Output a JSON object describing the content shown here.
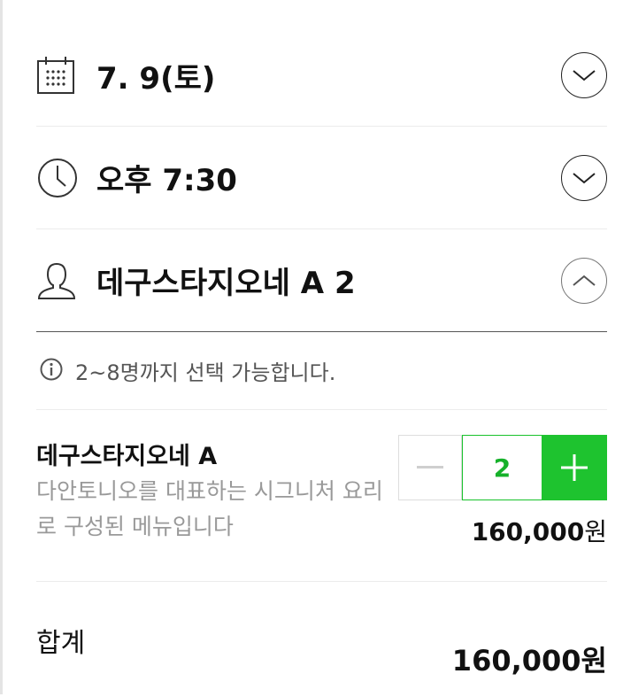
{
  "date": {
    "label": "7. 9(토)",
    "icon": "calendar-icon"
  },
  "time": {
    "label": "오후 7:30",
    "icon": "clock-icon"
  },
  "guest": {
    "label": "데구스타지오네 A 2",
    "icon": "person-icon"
  },
  "info": {
    "text": "2~8명까지 선택 가능합니다.",
    "icon": "info-icon"
  },
  "menu": {
    "name": "데구스타지오네 A",
    "description": "다안토니오를 대표하는 시그니처 요리로 구성된 메뉴입니다",
    "quantity": "2",
    "price": "160,000",
    "currency": "원"
  },
  "total": {
    "label": "합계",
    "price": "160,000",
    "currency": "원"
  },
  "colors": {
    "accent": "#1ec32f",
    "accent_text": "#16b12a",
    "muted": "#999999",
    "border": "#ececec"
  }
}
